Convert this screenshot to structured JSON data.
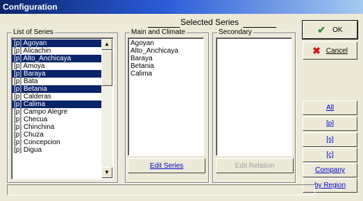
{
  "window": {
    "title": "Configuration"
  },
  "selected_series": {
    "title": "Selected Series"
  },
  "list_of_series": {
    "label": "List of Series",
    "items": [
      {
        "text": "[p] Agoyan",
        "selected": true
      },
      {
        "text": "[p] Alicachin",
        "selected": false
      },
      {
        "text": "[p] Alto_Anchicaya",
        "selected": true
      },
      {
        "text": "[p] Amoya",
        "selected": false
      },
      {
        "text": "[p] Baraya",
        "selected": true
      },
      {
        "text": "[p] Bata",
        "selected": false
      },
      {
        "text": "[p] Betania",
        "selected": true
      },
      {
        "text": "[p] Calderas",
        "selected": false
      },
      {
        "text": "[p] Calima",
        "selected": true
      },
      {
        "text": "[p] Campo Alegre",
        "selected": false
      },
      {
        "text": "[p] Checua",
        "selected": false
      },
      {
        "text": "[p] Chinchina",
        "selected": false
      },
      {
        "text": "[p] Chuza",
        "selected": false
      },
      {
        "text": "[p] Concepcion",
        "selected": false
      },
      {
        "text": "[p] Digua",
        "selected": false
      }
    ]
  },
  "main_and_climate": {
    "label": "Main and Climate",
    "items": [
      "Agoyan",
      "Alto_Anchicaya",
      "Baraya",
      "Betania",
      "Calima"
    ],
    "button_label": "Edit Series"
  },
  "secondary": {
    "label": "Secondary",
    "items": [],
    "button_label": "Edit Relation"
  },
  "buttons": {
    "ok": "OK",
    "cancel": "Cancel",
    "all": "All",
    "p": "[p]",
    "s": "[s]",
    "c": "[c]",
    "company": "Company",
    "by_region": "by Region"
  },
  "icons": {
    "ok": "check-icon",
    "cancel": "x-icon"
  },
  "colors": {
    "selection": "#0a246a",
    "title_bar": "#0a246a",
    "link_text": "#0000cc"
  },
  "status": {
    "text": ""
  }
}
